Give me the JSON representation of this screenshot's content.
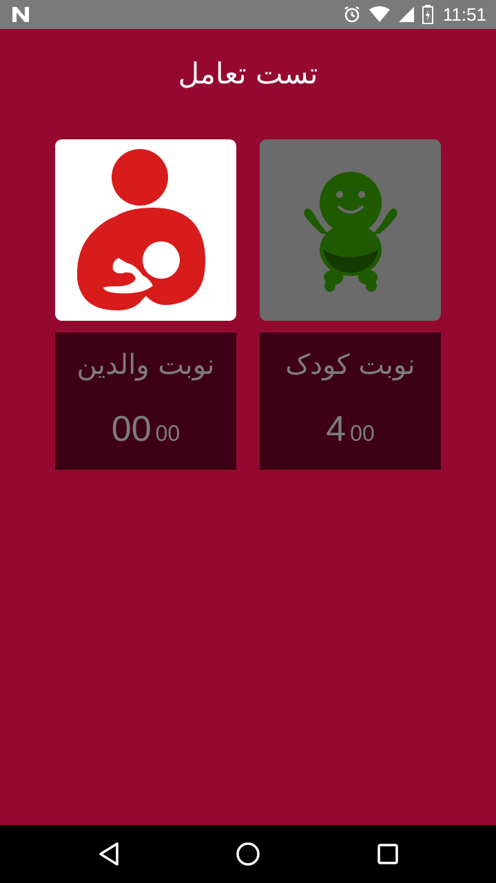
{
  "status_bar": {
    "time": "11:51",
    "icons": [
      "n-logo-icon",
      "alarm-icon",
      "wifi-icon",
      "signal-icon",
      "battery-icon"
    ]
  },
  "header": {
    "title": "تست تعامل"
  },
  "tiles": {
    "parent": {
      "icon": "breastfeeding-icon",
      "bg_color": "#ffffff",
      "icon_color": "#d81b1b"
    },
    "child": {
      "icon": "baby-icon",
      "bg_color": "#6b6b6b",
      "icon_color": "#1f5a00"
    }
  },
  "panels": {
    "parent": {
      "label": "نوبت والدین",
      "score_main": "00",
      "score_sub": "00"
    },
    "child": {
      "label": "نوبت کودک",
      "score_main": "4",
      "score_sub": "00"
    }
  },
  "nav": {
    "back": "back-icon",
    "home": "home-icon",
    "recents": "recents-icon"
  },
  "colors": {
    "background": "#950930",
    "panel": "#3d0014",
    "status_bar": "#7a7a7a"
  }
}
